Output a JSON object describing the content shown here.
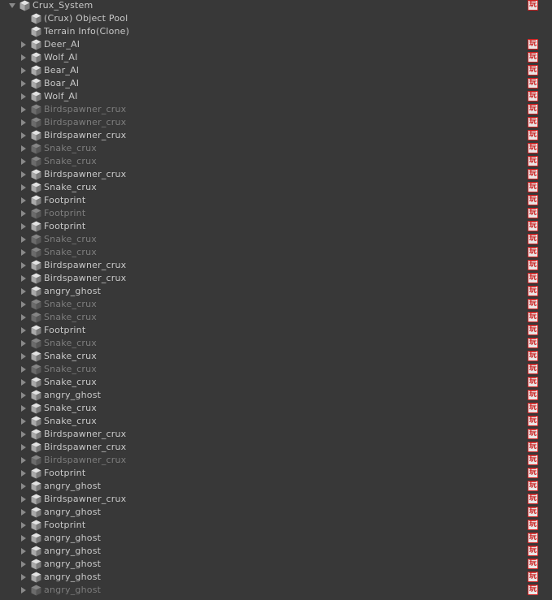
{
  "root": {
    "label": "Crux_System",
    "expanded": true,
    "badge": "玩"
  },
  "badge_glyph": "玩",
  "children": [
    {
      "label": "(Crux) Object Pool",
      "active": true,
      "has_children": false,
      "badge": false
    },
    {
      "label": "Terrain Info(Clone)",
      "active": true,
      "has_children": false,
      "badge": false
    },
    {
      "label": "Deer_AI",
      "active": true,
      "has_children": true,
      "badge": true
    },
    {
      "label": "Wolf_AI",
      "active": true,
      "has_children": true,
      "badge": true
    },
    {
      "label": "Bear_AI",
      "active": true,
      "has_children": true,
      "badge": true
    },
    {
      "label": "Boar_AI",
      "active": true,
      "has_children": true,
      "badge": true
    },
    {
      "label": "Wolf_AI",
      "active": true,
      "has_children": true,
      "badge": true
    },
    {
      "label": "Birdspawner_crux",
      "active": false,
      "has_children": true,
      "badge": true
    },
    {
      "label": "Birdspawner_crux",
      "active": false,
      "has_children": true,
      "badge": true
    },
    {
      "label": "Birdspawner_crux",
      "active": true,
      "has_children": true,
      "badge": true
    },
    {
      "label": "Snake_crux",
      "active": false,
      "has_children": true,
      "badge": true
    },
    {
      "label": "Snake_crux",
      "active": false,
      "has_children": true,
      "badge": true
    },
    {
      "label": "Birdspawner_crux",
      "active": true,
      "has_children": true,
      "badge": true
    },
    {
      "label": "Snake_crux",
      "active": true,
      "has_children": true,
      "badge": true
    },
    {
      "label": "Footprint",
      "active": true,
      "has_children": true,
      "badge": true
    },
    {
      "label": "Footprint",
      "active": false,
      "has_children": true,
      "badge": true
    },
    {
      "label": "Footprint",
      "active": true,
      "has_children": true,
      "badge": true
    },
    {
      "label": "Snake_crux",
      "active": false,
      "has_children": true,
      "badge": true
    },
    {
      "label": "Snake_crux",
      "active": false,
      "has_children": true,
      "badge": true
    },
    {
      "label": "Birdspawner_crux",
      "active": true,
      "has_children": true,
      "badge": true
    },
    {
      "label": "Birdspawner_crux",
      "active": true,
      "has_children": true,
      "badge": true
    },
    {
      "label": "angry_ghost",
      "active": true,
      "has_children": true,
      "badge": true
    },
    {
      "label": "Snake_crux",
      "active": false,
      "has_children": true,
      "badge": true
    },
    {
      "label": "Snake_crux",
      "active": false,
      "has_children": true,
      "badge": true
    },
    {
      "label": "Footprint",
      "active": true,
      "has_children": true,
      "badge": true
    },
    {
      "label": "Snake_crux",
      "active": false,
      "has_children": true,
      "badge": true
    },
    {
      "label": "Snake_crux",
      "active": true,
      "has_children": true,
      "badge": true
    },
    {
      "label": "Snake_crux",
      "active": false,
      "has_children": true,
      "badge": true
    },
    {
      "label": "Snake_crux",
      "active": true,
      "has_children": true,
      "badge": true
    },
    {
      "label": "angry_ghost",
      "active": true,
      "has_children": true,
      "badge": true
    },
    {
      "label": "Snake_crux",
      "active": true,
      "has_children": true,
      "badge": true
    },
    {
      "label": "Snake_crux",
      "active": true,
      "has_children": true,
      "badge": true
    },
    {
      "label": "Birdspawner_crux",
      "active": true,
      "has_children": true,
      "badge": true
    },
    {
      "label": "Birdspawner_crux",
      "active": true,
      "has_children": true,
      "badge": true
    },
    {
      "label": "Birdspawner_crux",
      "active": false,
      "has_children": true,
      "badge": true
    },
    {
      "label": "Footprint",
      "active": true,
      "has_children": true,
      "badge": true
    },
    {
      "label": "angry_ghost",
      "active": true,
      "has_children": true,
      "badge": true
    },
    {
      "label": "Birdspawner_crux",
      "active": true,
      "has_children": true,
      "badge": true
    },
    {
      "label": "angry_ghost",
      "active": true,
      "has_children": true,
      "badge": true
    },
    {
      "label": "Footprint",
      "active": true,
      "has_children": true,
      "badge": true
    },
    {
      "label": "angry_ghost",
      "active": true,
      "has_children": true,
      "badge": true
    },
    {
      "label": "angry_ghost",
      "active": true,
      "has_children": true,
      "badge": true
    },
    {
      "label": "angry_ghost",
      "active": true,
      "has_children": true,
      "badge": true
    },
    {
      "label": "angry_ghost",
      "active": true,
      "has_children": true,
      "badge": true
    },
    {
      "label": "angry_ghost",
      "active": false,
      "has_children": true,
      "badge": true
    }
  ],
  "colors": {
    "background": "#383838",
    "text_active": "#c8c8c8",
    "text_inactive": "#7d7d7d",
    "badge_bg": "#e9e6e6",
    "badge_border": "#d02020"
  },
  "icons": {
    "expand": "triangle-right-icon",
    "collapse": "triangle-down-icon",
    "gameobject": "cube-icon"
  }
}
